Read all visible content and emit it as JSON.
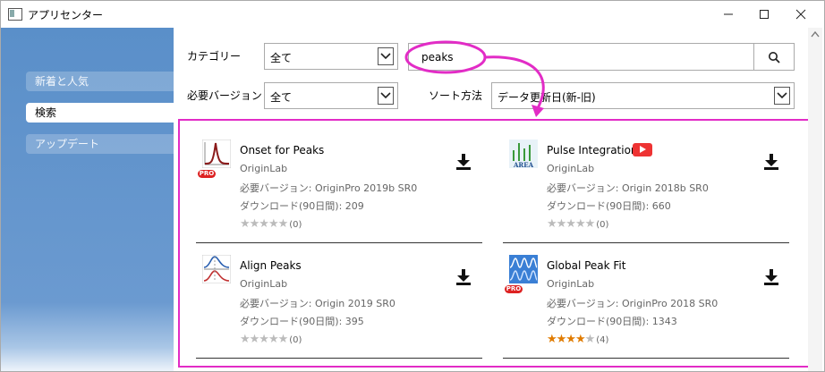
{
  "window": {
    "title": "アプリセンター"
  },
  "sidebar": {
    "items": [
      {
        "label": "新着と人気"
      },
      {
        "label": "検索"
      },
      {
        "label": "アップデート"
      }
    ]
  },
  "filters": {
    "category_label": "カテゴリー",
    "category_value": "全て",
    "version_label": "必要バージョン",
    "version_value": "全て",
    "sort_label": "ソート方法",
    "sort_value": "データ更新日(新-旧)",
    "search_value": "peaks"
  },
  "apps": [
    {
      "name": "Onset for Peaks",
      "publisher": "OriginLab",
      "req": "必要バージョン: OriginPro 2019b SR0",
      "downloads": "ダウンロード(90日間): 209",
      "rating": 0,
      "rating_count": "(0)",
      "pro": true,
      "video": false
    },
    {
      "name": "Pulse Integration",
      "publisher": "OriginLab",
      "req": "必要バージョン: Origin 2018b SR0",
      "downloads": "ダウンロード(90日間): 660",
      "rating": 0,
      "rating_count": "(0)",
      "pro": false,
      "video": true,
      "thumb_text": "AREA"
    },
    {
      "name": "Align Peaks",
      "publisher": "OriginLab",
      "req": "必要バージョン: Origin 2019 SR0",
      "downloads": "ダウンロード(90日間): 395",
      "rating": 0,
      "rating_count": "(0)",
      "pro": false,
      "video": false
    },
    {
      "name": "Global Peak Fit",
      "publisher": "OriginLab",
      "req": "必要バージョン: OriginPro 2018 SR0",
      "downloads": "ダウンロード(90日間): 1343",
      "rating": 4,
      "rating_count": "(4)",
      "pro": true,
      "video": false
    }
  ],
  "badges": {
    "pro_text": "PRO"
  },
  "icons": [
    "minimize-icon",
    "maximize-icon",
    "close-icon",
    "search-icon",
    "download-icon",
    "dropdown-arrow-icon",
    "youtube-icon"
  ],
  "colors": {
    "annotation": "#e22cc6",
    "sidebar": "#5a8fc9",
    "star_on": "#e07b00",
    "pro_badge": "#dd2222"
  }
}
